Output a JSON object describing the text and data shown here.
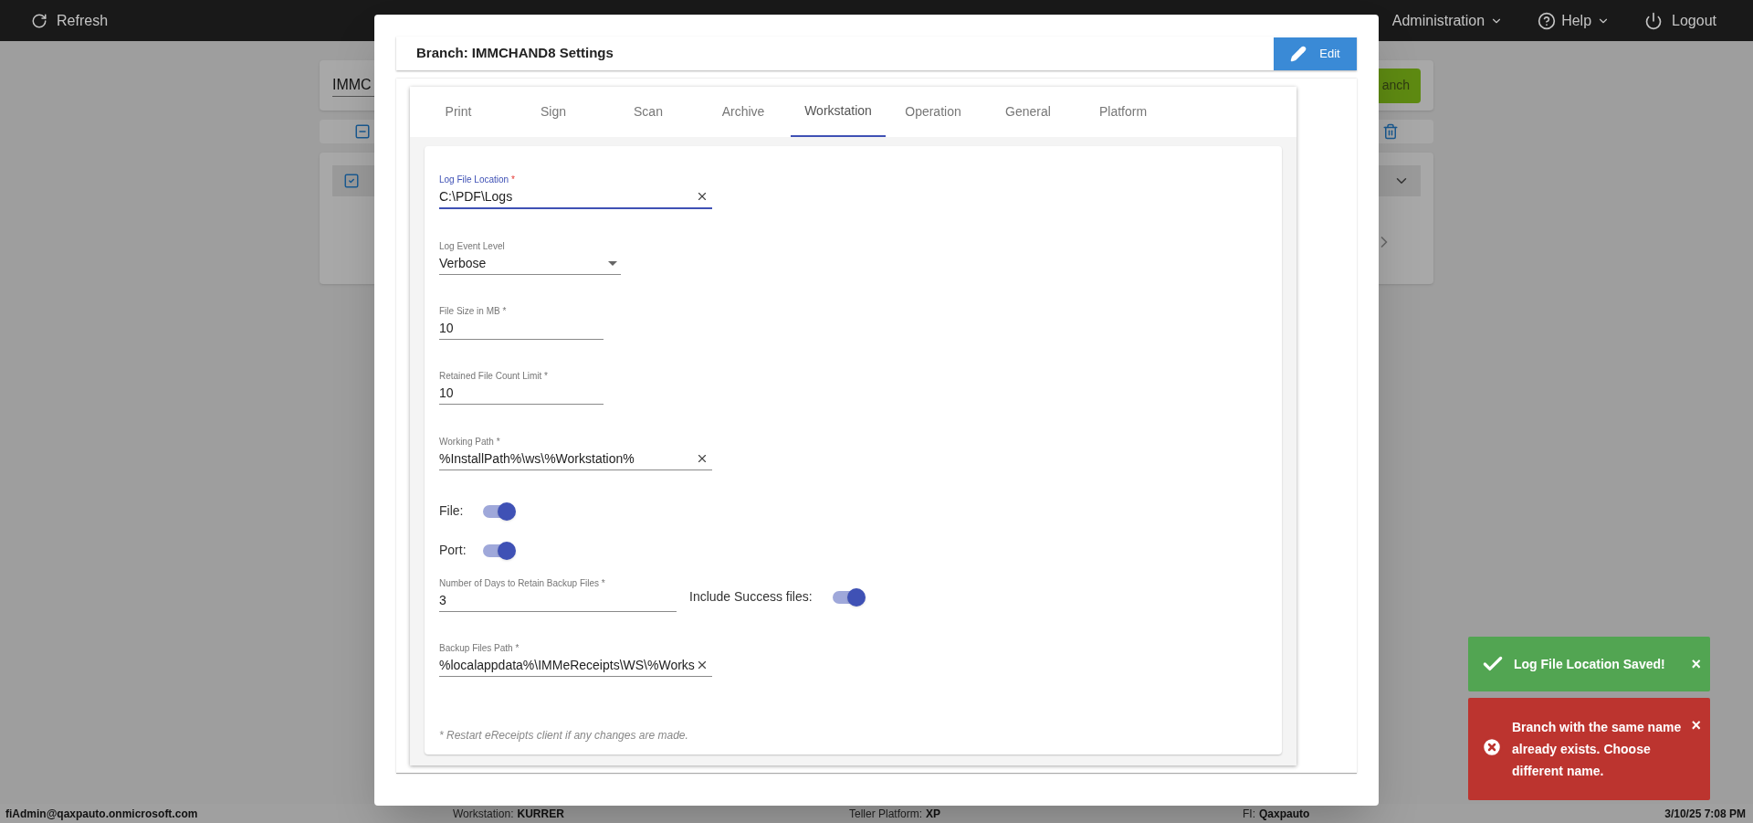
{
  "topbar": {
    "refresh": "Refresh",
    "menus": [
      {
        "label": "Administration"
      },
      {
        "label": "Help"
      }
    ],
    "logout": "Logout"
  },
  "background": {
    "search_value": "IMMC",
    "button": "anch"
  },
  "dialog": {
    "title": "Branch: IMMCHAND8 Settings",
    "edit_button": "Edit",
    "tabs": [
      {
        "label": "Print",
        "selected": false
      },
      {
        "label": "Sign",
        "selected": false
      },
      {
        "label": "Scan",
        "selected": false
      },
      {
        "label": "Archive",
        "selected": false
      },
      {
        "label": "Workstation",
        "selected": true
      },
      {
        "label": "Operation",
        "selected": false
      },
      {
        "label": "General",
        "selected": false
      },
      {
        "label": "Platform",
        "selected": false
      }
    ],
    "fields": [
      {
        "kind": "text",
        "label": "Log File Location",
        "required_mark": "*",
        "value": "C:\\PDF\\Logs",
        "clearable": true,
        "focused": true
      },
      {
        "kind": "select",
        "label": "Log Event Level",
        "value": "Verbose",
        "focused": false
      },
      {
        "kind": "text",
        "label": "File Size in MB",
        "required_mark": "*",
        "value": "10",
        "clearable": false,
        "focused": false
      },
      {
        "kind": "text",
        "label": "Retained File Count Limit",
        "required_mark": "*",
        "value": "10",
        "clearable": false,
        "focused": false
      },
      {
        "kind": "text",
        "label": "Working Path",
        "required_mark": "*",
        "value": "%InstallPath%\\ws\\%Workstation%",
        "clearable": true,
        "focused": false
      },
      {
        "kind": "toggle",
        "label": "File:",
        "on": true
      },
      {
        "kind": "toggle",
        "label": "Port:",
        "on": true
      },
      {
        "kind": "text",
        "label": "Number of Days to Retain Backup Files",
        "required_mark": "*",
        "value": "3",
        "clearable": false,
        "focused": false,
        "side_toggle": {
          "label": "Include Success files:",
          "on": true
        }
      },
      {
        "kind": "text",
        "label": "Backup Files Path",
        "required_mark": "*",
        "value": "%localappdata%\\IMMeReceipts\\WS\\%Works",
        "clearable": true,
        "focused": false
      }
    ],
    "note": "* Restart eReceipts client if any changes are made."
  },
  "toasts": [
    {
      "kind": "success",
      "message": "Log File Location Saved!",
      "close": "×"
    },
    {
      "kind": "error",
      "message": "Branch with the same name already exists. Choose different name.",
      "close": "×"
    }
  ],
  "status_bar": {
    "user": "fiAdmin@qaxpauto.onmicrosoft.com",
    "items": [
      {
        "label": "Workstation:",
        "value": "KURRER"
      },
      {
        "label": "Teller Platform:",
        "value": "XP"
      },
      {
        "label": "FI:",
        "value": "Qaxpauto"
      }
    ],
    "datetime": "3/10/25 7:08 PM"
  }
}
